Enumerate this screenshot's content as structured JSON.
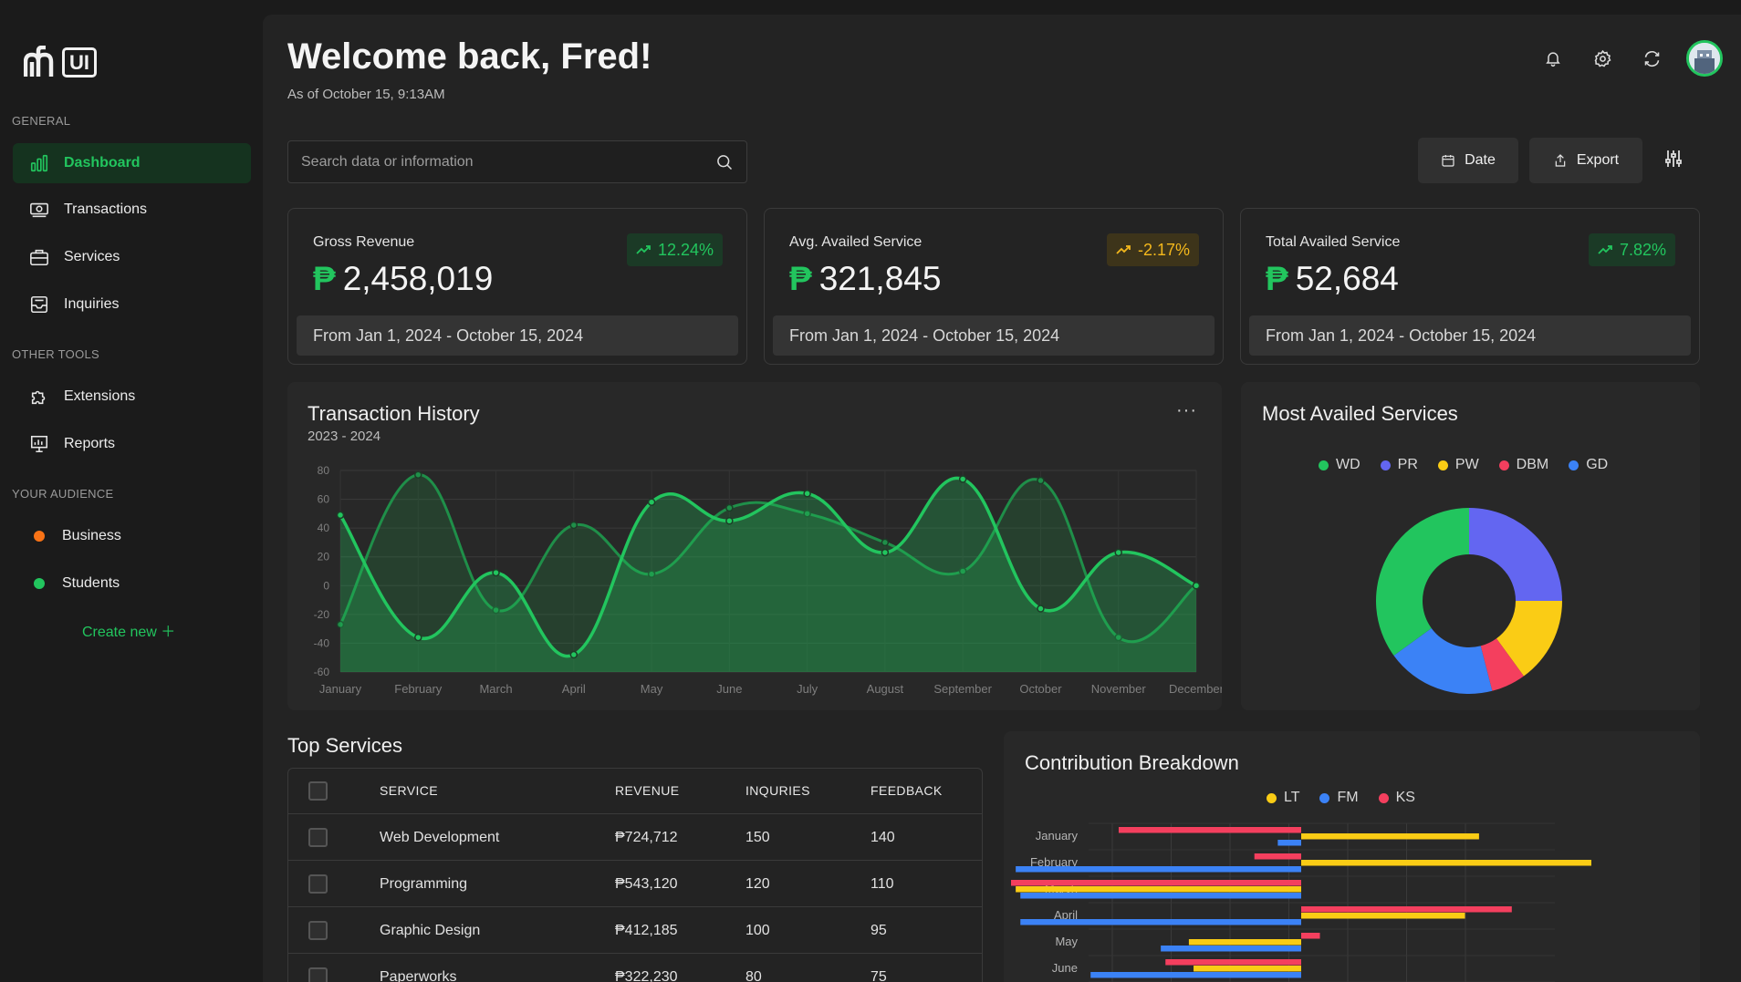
{
  "sidebar": {
    "logo_text": "UI",
    "sections": [
      "GENERAL",
      "OTHER TOOLS",
      "YOUR AUDIENCE"
    ],
    "general": [
      {
        "label": "Dashboard",
        "icon": "bar-chart-icon",
        "active": true
      },
      {
        "label": "Transactions",
        "icon": "cash-icon"
      },
      {
        "label": "Services",
        "icon": "briefcase-icon"
      },
      {
        "label": "Inquiries",
        "icon": "inbox-icon"
      }
    ],
    "tools": [
      {
        "label": "Extensions",
        "icon": "puzzle-icon"
      },
      {
        "label": "Reports",
        "icon": "presentation-chart-icon"
      }
    ],
    "audience": [
      {
        "label": "Business",
        "color": "#f97316"
      },
      {
        "label": "Students",
        "color": "#22c55e"
      }
    ],
    "create_new": "Create new ＋"
  },
  "header": {
    "title": "Welcome back, Fred!",
    "subtitle": "As of October 15, 9:13AM",
    "icons": [
      "bell-icon",
      "gear-icon",
      "refresh-icon",
      "avatar"
    ]
  },
  "search": {
    "placeholder": "Search data or information"
  },
  "actions": {
    "date": "Date",
    "export": "Export",
    "filter_icon": "sliders-icon"
  },
  "stats": [
    {
      "label": "Gross Revenue",
      "currency": "₱",
      "value": "2,458,019",
      "change": "12.24%",
      "trend": "up",
      "range": "From Jan 1, 2024 - October 15, 2024"
    },
    {
      "label": "Avg. Availed Service",
      "currency": "₱",
      "value": "321,845",
      "change": "-2.17%",
      "trend": "down",
      "range": "From Jan 1, 2024 - October 15, 2024"
    },
    {
      "label": "Total Availed Service",
      "currency": "₱",
      "value": "52,684",
      "change": "7.82%",
      "trend": "up",
      "range": "From Jan 1, 2024 - October 15, 2024"
    }
  ],
  "colors": {
    "accent": "#22c55e",
    "warning": "#f4b81c",
    "bg": "#1b1b1b",
    "panel": "#282828"
  },
  "transaction_history": {
    "title": "Transaction History",
    "subtitle": "2023 - 2024",
    "more": "···"
  },
  "most_availed": {
    "title": "Most Availed Services"
  },
  "contribution": {
    "title": "Contribution Breakdown"
  },
  "top_services": {
    "title": "Top Services",
    "columns": [
      "SERVICE",
      "REVENUE",
      "INQURIES",
      "FEEDBACK"
    ],
    "rows": [
      [
        "Web Development",
        "₱724,712",
        "150",
        "140"
      ],
      [
        "Programming",
        "₱543,120",
        "120",
        "110"
      ],
      [
        "Graphic Design",
        "₱412,185",
        "100",
        "95"
      ],
      [
        "Paperworks",
        "₱322,230",
        "80",
        "75"
      ]
    ]
  },
  "chart_data": [
    {
      "type": "area",
      "title": "Transaction History",
      "subtitle": "2023 - 2024",
      "categories": [
        "January",
        "February",
        "March",
        "April",
        "May",
        "June",
        "July",
        "August",
        "September",
        "October",
        "November",
        "December"
      ],
      "ylim": [
        -60,
        80
      ],
      "yticks": [
        80,
        60,
        40,
        20,
        0,
        -20,
        -40,
        -60
      ],
      "grid": true,
      "series": [
        {
          "values": [
            49,
            -36,
            9,
            -48,
            58,
            45,
            64,
            23,
            74,
            -16,
            23,
            0
          ]
        },
        {
          "values": [
            -27,
            77,
            -17,
            42,
            8,
            54,
            50,
            30,
            10,
            73,
            -36,
            0
          ]
        }
      ]
    },
    {
      "type": "pie",
      "title": "Most Availed Services",
      "legend_position": "top",
      "labels": [
        "WD",
        "PR",
        "PW",
        "DBM",
        "GD"
      ],
      "values": [
        35,
        25,
        15,
        6,
        19
      ],
      "colors": [
        "#22c55e",
        "#6366f1",
        "#facc15",
        "#f43f5e",
        "#3b82f6"
      ]
    },
    {
      "type": "bar",
      "title": "Contribution Breakdown",
      "orientation": "horizontal",
      "legend_position": "top",
      "categories": [
        "January",
        "February",
        "March",
        "April",
        "May",
        "June"
      ],
      "xlim": [
        -62,
        62
      ],
      "series": [
        {
          "name": "LT",
          "color": "#facc15",
          "values": [
            38,
            62,
            -61,
            35,
            -24,
            -23
          ]
        },
        {
          "name": "FM",
          "color": "#3b82f6",
          "values": [
            -5,
            -61,
            -60,
            -60,
            -30,
            -45
          ]
        },
        {
          "name": "KS",
          "color": "#f43f5e",
          "values": [
            -39,
            -10,
            -62,
            45,
            4,
            -29
          ]
        }
      ]
    }
  ]
}
